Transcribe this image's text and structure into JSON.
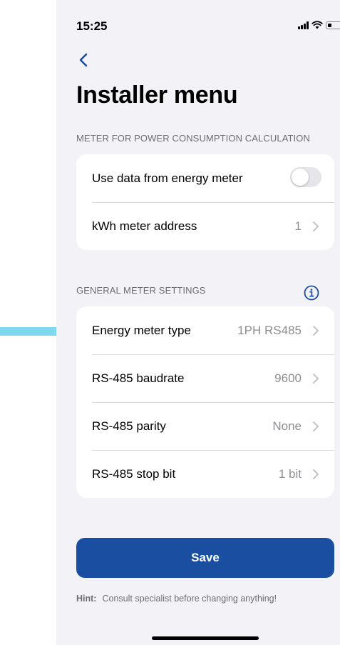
{
  "status_bar": {
    "time": "15:25"
  },
  "nav": {
    "title": "Installer menu"
  },
  "section_power": {
    "header": "METER FOR POWER CONSUMPTION CALCULATION",
    "rows": [
      {
        "label": "Use data from energy meter",
        "toggle_on": false
      },
      {
        "label": "kWh meter address",
        "value": "1"
      }
    ]
  },
  "section_general": {
    "header": "GENERAL METER SETTINGS",
    "rows": [
      {
        "label": "Energy meter type",
        "value": "1PH RS485"
      },
      {
        "label": "RS-485 baudrate",
        "value": "9600"
      },
      {
        "label": "RS-485 parity",
        "value": "None"
      },
      {
        "label": "RS-485 stop bit",
        "value": "1 bit"
      }
    ]
  },
  "save_button": {
    "label": "Save"
  },
  "hint": {
    "label": "Hint:",
    "text": "Consult specialist before changing anything!"
  },
  "colors": {
    "accent": "#1a4ea1",
    "highlight_arrow": "#7fd9ee",
    "background": "#f2f2f7"
  },
  "icons": {
    "back": "chevron-left-icon",
    "info": "info-circle-icon",
    "row_disclosure": "chevron-right-icon",
    "annotation": "arrow-right-icon"
  }
}
